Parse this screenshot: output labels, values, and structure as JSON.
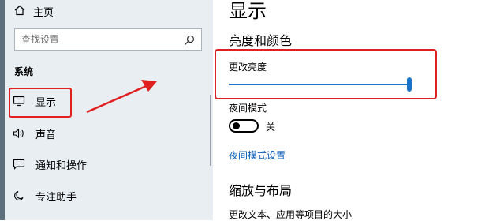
{
  "sidebar": {
    "home_label": "主页",
    "search_placeholder": "查找设置",
    "section_label": "系统",
    "items": [
      {
        "label": "显示",
        "icon": "monitor-icon"
      },
      {
        "label": "声音",
        "icon": "speaker-icon"
      },
      {
        "label": "通知和操作",
        "icon": "notification-icon"
      },
      {
        "label": "专注助手",
        "icon": "moon-icon"
      }
    ]
  },
  "main": {
    "page_title": "显示",
    "brightness_heading": "亮度和颜色",
    "change_brightness_label": "更改亮度",
    "brightness_level": 1.0,
    "night_light_label": "夜间模式",
    "night_light_state": "关",
    "night_light_settings_link": "夜间模式设置",
    "scale_heading": "缩放与布局",
    "text_size_label": "更改文本、应用等项目的大小"
  },
  "colors": {
    "accent": "#1a73c8",
    "highlight": "#e02020",
    "sidebar_bg": "#e9eef3"
  }
}
